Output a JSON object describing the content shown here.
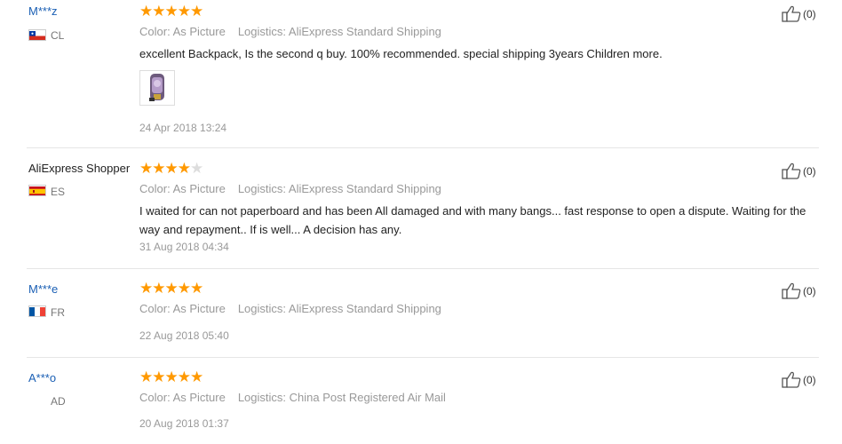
{
  "reviews": [
    {
      "user": "M***z",
      "country": "CL",
      "rating": 5,
      "color_label": "Color: As Picture",
      "logistics": "Logistics: AliExpress Standard Shipping",
      "comment": "excellent Backpack, Is the second q buy. 100% recommended. special shipping 3years Children more.",
      "date": "24 Apr 2018 13:24",
      "likes": "(0)"
    },
    {
      "user": "AliExpress Shopper",
      "country": "ES",
      "rating": 4,
      "color_label": "Color: As Picture",
      "logistics": "Logistics: AliExpress Standard Shipping",
      "comment": "I waited for can not paperboard and has been All damaged and with many bangs... fast response to open a dispute. Waiting for the way and repayment.. If is well... A decision has any.",
      "date": "31 Aug 2018 04:34",
      "likes": "(0)"
    },
    {
      "user": "M***e",
      "country": "FR",
      "rating": 5,
      "color_label": "Color: As Picture",
      "logistics": "Logistics: AliExpress Standard Shipping",
      "date": "22 Aug 2018 05:40",
      "likes": "(0)"
    },
    {
      "user": "A***o",
      "country": "AD",
      "rating": 5,
      "color_label": "Color: As Picture",
      "logistics": "Logistics: China Post Registered Air Mail",
      "date": "20 Aug 2018 01:37",
      "likes": "(0)"
    }
  ],
  "colors": {
    "star": "#ff9900",
    "username_link": "#1a5fb4",
    "meta_text": "#999999"
  },
  "icons": {
    "like": "thumbs-up-icon",
    "star": "star-icon"
  }
}
